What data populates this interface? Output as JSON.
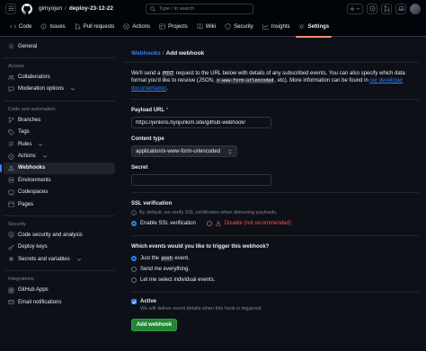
{
  "colors": {
    "accent": "#2f81f7",
    "tab_underline": "#fd8c73",
    "primary_button": "#238636",
    "danger": "#f85149",
    "background": "#0d1117"
  },
  "topbar": {
    "menu_icon": "hamburger-icon",
    "logo_icon": "github-logo-icon",
    "owner": "gimyojun",
    "separator": "/",
    "repo": "deploy-23-12-22",
    "search_placeholder": "Type / to search",
    "search_key_hint": "/",
    "plus_label": "+",
    "icons": [
      "plus-icon",
      "circle-icon",
      "pull-request-icon",
      "inbox-icon",
      "avatar"
    ]
  },
  "repo_nav": {
    "tabs": [
      {
        "label": "Code",
        "icon": "code-icon",
        "active": false
      },
      {
        "label": "Issues",
        "icon": "issue-icon",
        "active": false
      },
      {
        "label": "Pull requests",
        "icon": "pull-request-icon",
        "active": false
      },
      {
        "label": "Actions",
        "icon": "play-icon",
        "active": false
      },
      {
        "label": "Projects",
        "icon": "table-icon",
        "active": false
      },
      {
        "label": "Wiki",
        "icon": "book-icon",
        "active": false
      },
      {
        "label": "Security",
        "icon": "shield-icon",
        "active": false
      },
      {
        "label": "Insights",
        "icon": "graph-icon",
        "active": false
      },
      {
        "label": "Settings",
        "icon": "gear-icon",
        "active": true
      }
    ]
  },
  "sidebar": {
    "sections": [
      {
        "title": "",
        "items": [
          {
            "label": "General",
            "icon": "gear-icon"
          }
        ]
      },
      {
        "title": "Access",
        "items": [
          {
            "label": "Collaborators",
            "icon": "people-icon"
          },
          {
            "label": "Moderation options",
            "icon": "comment-icon",
            "chevron": true
          }
        ]
      },
      {
        "title": "Code and automation",
        "items": [
          {
            "label": "Branches",
            "icon": "git-branch-icon"
          },
          {
            "label": "Tags",
            "icon": "tag-icon"
          },
          {
            "label": "Rules",
            "icon": "rules-icon",
            "chevron": true
          },
          {
            "label": "Actions",
            "icon": "play-icon",
            "chevron": true
          },
          {
            "label": "Webhooks",
            "icon": "webhook-icon",
            "selected": true
          },
          {
            "label": "Environments",
            "icon": "server-icon"
          },
          {
            "label": "Codespaces",
            "icon": "codespaces-icon"
          },
          {
            "label": "Pages",
            "icon": "browser-icon"
          }
        ]
      },
      {
        "title": "Security",
        "items": [
          {
            "label": "Code security and analysis",
            "icon": "shield-lock-icon"
          },
          {
            "label": "Deploy keys",
            "icon": "key-icon"
          },
          {
            "label": "Secrets and variables",
            "icon": "asterisk-icon",
            "chevron": true
          }
        ]
      },
      {
        "title": "Integrations",
        "items": [
          {
            "label": "GitHub Apps",
            "icon": "apps-icon"
          },
          {
            "label": "Email notifications",
            "icon": "mail-icon"
          }
        ]
      }
    ]
  },
  "main": {
    "header": {
      "parent_link": "Webhooks",
      "separator": "/",
      "title": "Add webhook"
    },
    "intro": {
      "part1": "We'll send a ",
      "code1": "POST",
      "part2": " request to the URL below with details of any subscribed events. You can also specify which data format you'd like to receive (JSON, ",
      "code2": "x-www-form-urlencoded",
      "part3": ", etc). More information can be found in ",
      "link": "our developer documentation",
      "part4": "."
    },
    "payload_url": {
      "label": "Payload URL",
      "required_mark": "*",
      "value": "https://jenkins.hyojunkim.site/github-webhook/"
    },
    "content_type": {
      "label": "Content type",
      "value": "application/x-www-form-urlencoded"
    },
    "secret": {
      "label": "Secret",
      "value": ""
    },
    "ssl": {
      "label": "SSL verification",
      "note": "By default, we verify SSL certificates when delivering payloads.",
      "enable_label": "Enable SSL verification",
      "disable_label": "Disable (not recommended)",
      "selected": "enable"
    },
    "events": {
      "question": "Which events would you like to trigger this webhook?",
      "push_prefix": "Just the ",
      "push_code": "push",
      "push_suffix": " event.",
      "everything": "Send me everything.",
      "individual": "Let me select individual events.",
      "selected": "push"
    },
    "active": {
      "label": "Active",
      "checked": true,
      "note": "We will deliver event details when this hook is triggered."
    },
    "submit_label": "Add webhook"
  }
}
